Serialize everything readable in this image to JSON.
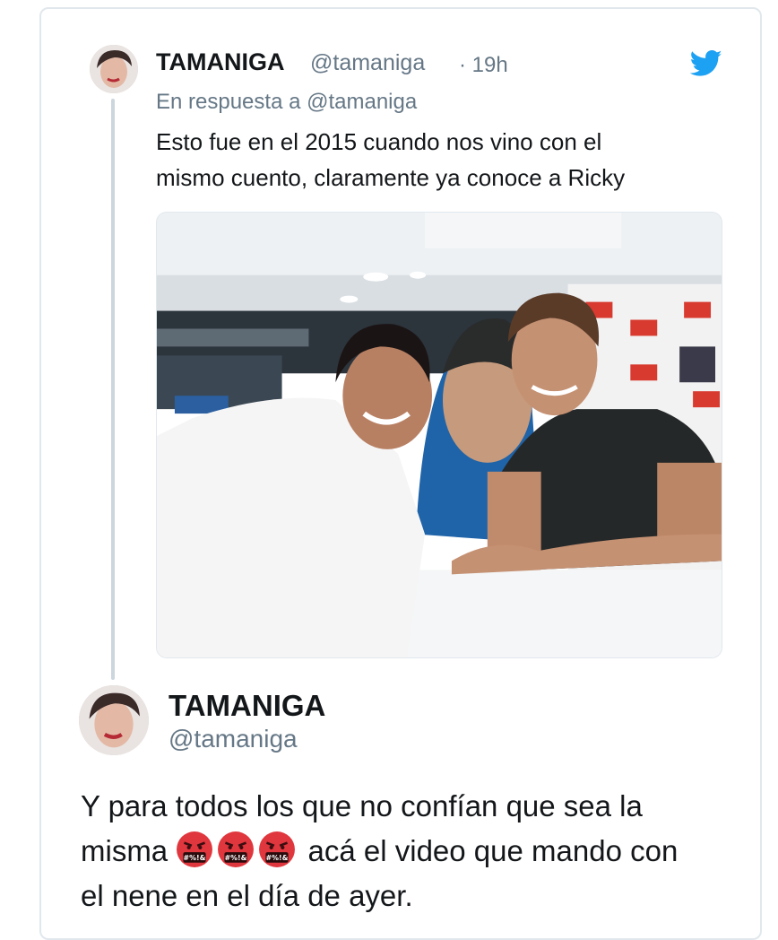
{
  "quoted_tweet": {
    "name": "TAMANIGA",
    "handle": "@tamaniga",
    "time": "· 19h",
    "reply_to": "En respuesta a @tamaniga",
    "text_lines": [
      "Esto fue en el 2015 cuando nos vino con el",
      "mismo cuento, claramente ya conoce a Ricky"
    ]
  },
  "main_tweet": {
    "name": "TAMANIGA",
    "handle": "@tamaniga",
    "line1": "Y para todos los que no confían que sea la",
    "line2_before": "misma",
    "line2_after": "acá el video que mando con",
    "line3": "el nene en el día de ayer.",
    "emoji_label": "#%!&",
    "emoji_count": 3
  },
  "colors": {
    "twitter_blue": "#1da1f2",
    "secondary_text": "#657786",
    "border": "#e1e8ed",
    "emoji_red": "#e0363d"
  },
  "icons": {
    "brand": "twitter-bird-icon",
    "emoji": "face-with-symbols-on-mouth-icon"
  }
}
